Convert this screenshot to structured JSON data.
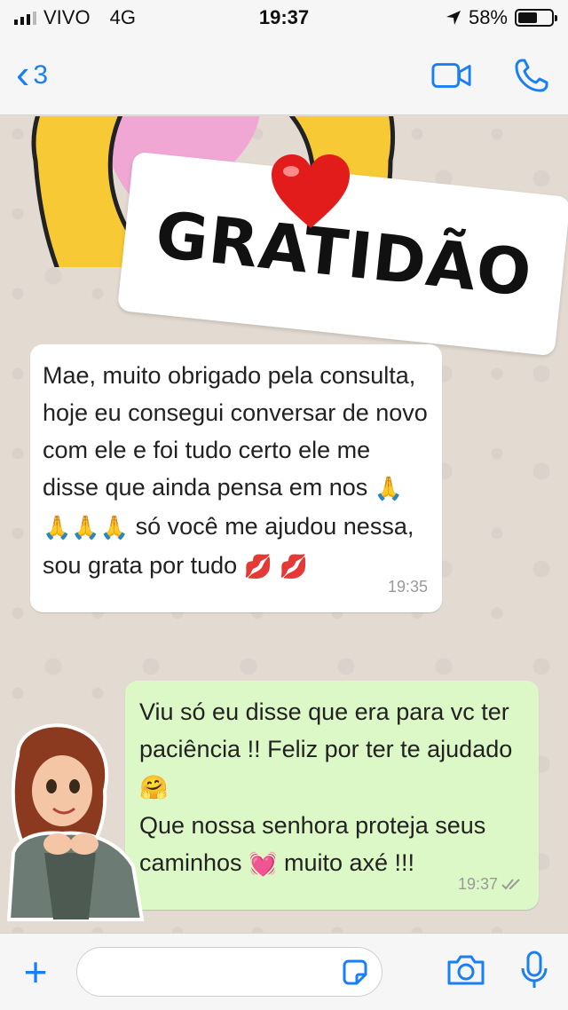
{
  "status": {
    "carrier": "VIVO",
    "network": "4G",
    "time": "19:37",
    "battery": "58%",
    "battery_level": 0.58
  },
  "header": {
    "back_count": "3"
  },
  "sticker_text": "GRATIDÃO",
  "messages": {
    "incoming": {
      "text": "Mae, muito obrigado pela consulta, hoje eu consegui conversar de novo com ele e foi tudo certo ele me disse que ainda pensa em nos",
      "text2": "só você me ajudou nessa, sou grata por tudo",
      "time": "19:35"
    },
    "outgoing": {
      "text1": "Viu só eu disse que era para vc ter paciência !! Feliz por ter te ajudado",
      "text2": "Que nossa senhora proteja seus caminhos",
      "text3": "muito axé !!!",
      "time": "19:37"
    }
  },
  "colors": {
    "accent": "#1a7ff5",
    "outgoing_bubble": "#dcf8c6",
    "incoming_bubble": "#ffffff"
  }
}
